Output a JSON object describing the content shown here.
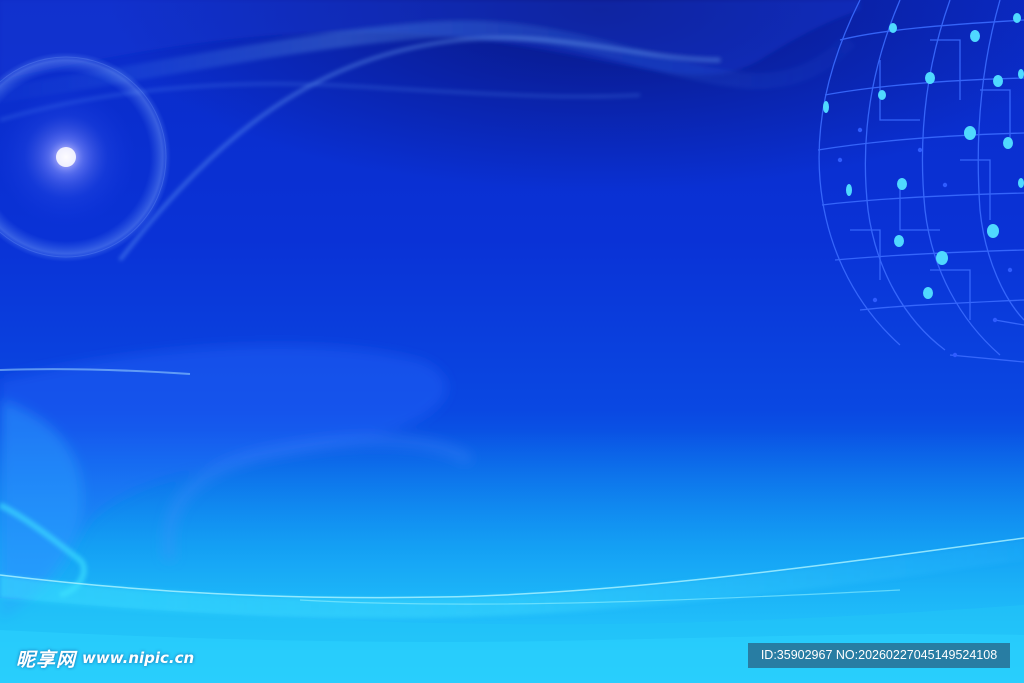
{
  "watermark": {
    "logo_cn": "昵享网",
    "logo_url": "www.nipic.cn",
    "image_id": "ID:35902967 NO:20260227045149524108"
  },
  "colors": {
    "background_deep": "#0b2bc8",
    "background_mid": "#0a48e2",
    "background_light": "#19b6f6",
    "wave_highlight": "#3fe6ff",
    "node_dot": "#4fd9ff",
    "circuit_line": "#3a6bff",
    "lens_flare": "#d9d6ff"
  },
  "scene": {
    "description_icons": [
      "lens-flare-icon",
      "circuit-globe-icon",
      "light-wave-icon"
    ]
  }
}
